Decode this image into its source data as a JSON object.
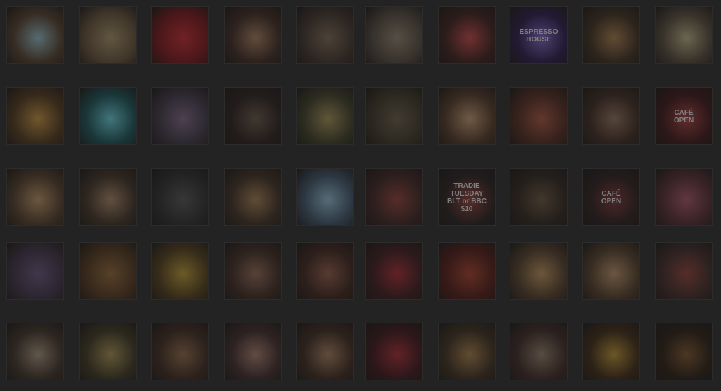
{
  "gallery": {
    "rows": 5,
    "cols": 10,
    "tiles": [
      {
        "name": "photo-latte-art",
        "color": "#4a3a2c",
        "accent": "#7a9aa0",
        "label": ""
      },
      {
        "name": "photo-breakfast-plate",
        "color": "#5a4a36",
        "accent": "#8a7a5a",
        "label": ""
      },
      {
        "name": "photo-red-hibiscus",
        "color": "#6a1a1e",
        "accent": "#a02a30",
        "label": ""
      },
      {
        "name": "photo-drinks-fridge",
        "color": "#3a2a24",
        "accent": "#8a6a50",
        "label": ""
      },
      {
        "name": "photo-cake-display",
        "color": "#3c322c",
        "accent": "#6a5a4a",
        "label": ""
      },
      {
        "name": "photo-pastry-display",
        "color": "#4a423a",
        "accent": "#7a6e5e",
        "label": ""
      },
      {
        "name": "photo-ice-cream-cups",
        "color": "#3a2220",
        "accent": "#a04040",
        "label": ""
      },
      {
        "name": "photo-espresso-house-sign",
        "color": "#2a1e44",
        "accent": "#6a5aa0",
        "label": "ESPRESSO\nHOUSE"
      },
      {
        "name": "photo-iced-coffee-glass",
        "color": "#3a2e22",
        "accent": "#8a6a42",
        "label": ""
      },
      {
        "name": "photo-milkshake",
        "color": "#4a4236",
        "accent": "#9a9070",
        "label": ""
      },
      {
        "name": "photo-bagels",
        "color": "#4a3620",
        "accent": "#a07a3a",
        "label": ""
      },
      {
        "name": "photo-roccabella-cups",
        "color": "#1e4a4e",
        "accent": "#5aa8b0",
        "label": ""
      },
      {
        "name": "photo-jacaranda-tree",
        "color": "#3a3440",
        "accent": "#6a5a70",
        "label": ""
      },
      {
        "name": "photo-takeaway-cup",
        "color": "#2a2220",
        "accent": "#5a4a40",
        "label": ""
      },
      {
        "name": "photo-salad-bowl",
        "color": "#3a3a28",
        "accent": "#8a7a4a",
        "label": ""
      },
      {
        "name": "photo-street-view",
        "color": "#3a3428",
        "accent": "#5a5040",
        "label": ""
      },
      {
        "name": "photo-coffee-beans-hand",
        "color": "#4a3628",
        "accent": "#a08060",
        "label": ""
      },
      {
        "name": "photo-shopfront-flowers",
        "color": "#4a2a22",
        "accent": "#8a4a3a",
        "label": ""
      },
      {
        "name": "photo-mug-coffee",
        "color": "#3a2a22",
        "accent": "#7a6050",
        "label": ""
      },
      {
        "name": "photo-cafe-open-sign",
        "color": "#3a1a1c",
        "accent": "#8a3a3a",
        "label": "CAFÉ\nOPEN"
      },
      {
        "name": "photo-cakes-table",
        "color": "#4a3a2a",
        "accent": "#9a7a58",
        "label": ""
      },
      {
        "name": "photo-cappuccino",
        "color": "#3c3026",
        "accent": "#8a7058",
        "label": ""
      },
      {
        "name": "photo-car-outside",
        "color": "#2c2c2c",
        "accent": "#4a4a4a",
        "label": ""
      },
      {
        "name": "photo-latte-saucer",
        "color": "#3a2e24",
        "accent": "#8a6a4a",
        "label": ""
      },
      {
        "name": "photo-blue-blur",
        "color": "#3a4a5a",
        "accent": "#7a9aaa",
        "label": ""
      },
      {
        "name": "photo-barista",
        "color": "#3a2624",
        "accent": "#7a3a34",
        "label": ""
      },
      {
        "name": "photo-tradie-tuesday",
        "color": "#2a2222",
        "accent": "#7a3a34",
        "label": "TRADIE\nTUESDAY\nBLT or BBC\n$10"
      },
      {
        "name": "photo-staff-group",
        "color": "#2e2620",
        "accent": "#5a4a3a",
        "label": ""
      },
      {
        "name": "photo-espresso-house-open",
        "color": "#2a2020",
        "accent": "#6a3030",
        "label": "CAFÉ\nOPEN"
      },
      {
        "name": "photo-shopfront-balloons",
        "color": "#4a2a2e",
        "accent": "#8a4a5a",
        "label": ""
      },
      {
        "name": "photo-bread-rolls",
        "color": "#3a3040",
        "accent": "#5a4a6a",
        "label": ""
      },
      {
        "name": "photo-wooden-table",
        "color": "#4a3420",
        "accent": "#7a5a34",
        "label": ""
      },
      {
        "name": "photo-juice-glass",
        "color": "#4a3a1e",
        "accent": "#9a8030",
        "label": ""
      },
      {
        "name": "photo-iced-latte",
        "color": "#3a2a24",
        "accent": "#7a5a4a",
        "label": ""
      },
      {
        "name": "photo-latte-heart",
        "color": "#3a2620",
        "accent": "#7a5040",
        "label": ""
      },
      {
        "name": "photo-red-napkin",
        "color": "#3a1e20",
        "accent": "#8a2a30",
        "label": ""
      },
      {
        "name": "photo-red-banner",
        "color": "#4a1e1a",
        "accent": "#8a3a2a",
        "label": ""
      },
      {
        "name": "photo-bundt-cake",
        "color": "#4a3a2a",
        "accent": "#9a7a50",
        "label": ""
      },
      {
        "name": "photo-smoothies",
        "color": "#4a3a2a",
        "accent": "#9a7a5a",
        "label": ""
      },
      {
        "name": "photo-storefront",
        "color": "#3a2a28",
        "accent": "#7a3a34",
        "label": ""
      },
      {
        "name": "photo-latte-cup",
        "color": "#3a3028",
        "accent": "#8a7a68",
        "label": ""
      },
      {
        "name": "photo-food-plate",
        "color": "#3a3424",
        "accent": "#8a7a4a",
        "label": ""
      },
      {
        "name": "photo-tart-slice",
        "color": "#3a2a22",
        "accent": "#7a5a40",
        "label": ""
      },
      {
        "name": "photo-cheesecake",
        "color": "#3a2a2a",
        "accent": "#8a6a5a",
        "label": ""
      },
      {
        "name": "photo-flat-white",
        "color": "#3a2a22",
        "accent": "#8a6a50",
        "label": ""
      },
      {
        "name": "photo-strawberries",
        "color": "#3a1a1e",
        "accent": "#8a2a30",
        "label": ""
      },
      {
        "name": "photo-croissants",
        "color": "#3a2e22",
        "accent": "#8a6a40",
        "label": ""
      },
      {
        "name": "photo-cup-saucer",
        "color": "#3a2a26",
        "accent": "#7a6a5a",
        "label": ""
      },
      {
        "name": "photo-yellow-lily",
        "color": "#3a2a1a",
        "accent": "#9a7a30",
        "label": ""
      },
      {
        "name": "photo-coffee-crema",
        "color": "#2a2018",
        "accent": "#6a4a2a",
        "label": ""
      }
    ]
  }
}
